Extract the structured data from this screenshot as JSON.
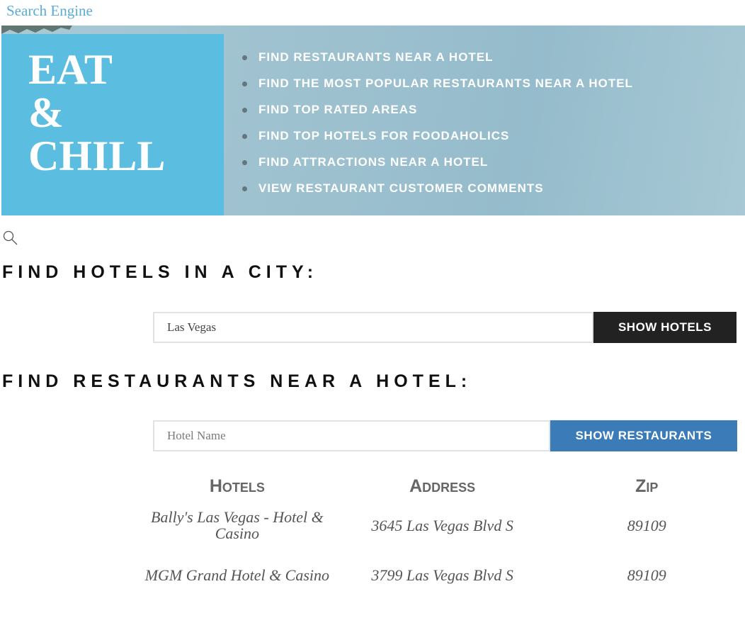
{
  "top_link": "Search Engine",
  "hero": {
    "title_lines": [
      "EAT",
      "&",
      "CHILL"
    ],
    "menu": [
      "FIND RESTAURANTS NEAR A HOTEL",
      "FIND THE MOST POPULAR RESTAURANTS NEAR A HOTEL",
      "FIND TOP RATED AREAS",
      "FIND TOP HOTELS FOR FOODAHOLICS",
      "FIND ATTRACTIONS NEAR A HOTEL",
      "VIEW RESTAURANT CUSTOMER COMMENTS"
    ]
  },
  "hotels_search": {
    "title": "FIND HOTELS IN A CITY:",
    "input_value": "Las Vegas",
    "button_label": "SHOW HOTELS"
  },
  "restaurants_search": {
    "title": "FIND RESTAURANTS NEAR A HOTEL:",
    "input_placeholder": "Hotel Name",
    "button_label": "SHOW RESTAURANTS"
  },
  "results": {
    "columns": [
      "Hotels",
      "Address",
      "Zip"
    ],
    "rows": [
      {
        "hotel": "Bally's Las Vegas - Hotel & Casino",
        "address": "3645 Las Vegas Blvd S",
        "zip": "89109"
      },
      {
        "hotel": "MGM Grand Hotel & Casino",
        "address": "3799 Las Vegas Blvd S",
        "zip": "89109"
      }
    ]
  },
  "icons": {
    "search": "search-icon"
  },
  "colors": {
    "link": "#5aacd6",
    "hero_box": "#5bbde0",
    "button_dark": "#222222",
    "button_blue": "#3a7bb8"
  }
}
